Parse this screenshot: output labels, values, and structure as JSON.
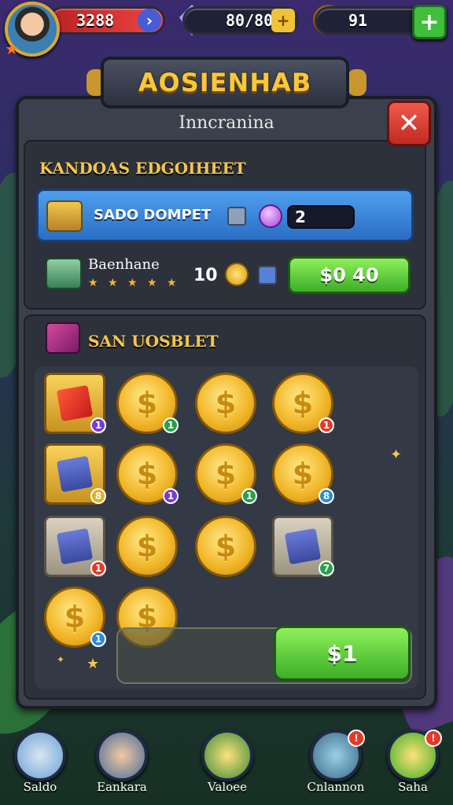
{
  "top_bar": {
    "health_value": "3288",
    "gems_value": "80/80",
    "coins_value": "91",
    "plus_label": "+"
  },
  "title": "AOSIENHAB",
  "panel": {
    "subtitle": "Inncranina",
    "close_label": "✕"
  },
  "section1": {
    "heading": "KANDOAS EDGOIHEET",
    "offer1": {
      "label": "SADO DOMPET",
      "quantity": "2"
    },
    "offer2": {
      "name": "Baenhane",
      "stars": "★ ★ ★ ★ ★",
      "count": "10",
      "price": "$0 40"
    }
  },
  "section2": {
    "heading": "SAN UOSBLET",
    "items": [
      {
        "type": "card",
        "badge": "1"
      },
      {
        "type": "coin",
        "badge": "1"
      },
      {
        "type": "coin",
        "badge": ""
      },
      {
        "type": "coin",
        "badge": "1"
      },
      {
        "type": "card",
        "badge": "8"
      },
      {
        "type": "coin",
        "badge": "1"
      },
      {
        "type": "coin",
        "badge": "1"
      },
      {
        "type": "coin",
        "badge": "8"
      },
      {
        "type": "card",
        "badge": "1"
      },
      {
        "type": "coin",
        "badge": ""
      },
      {
        "type": "coin",
        "badge": ""
      },
      {
        "type": "card",
        "badge": "7"
      },
      {
        "type": "coin",
        "badge": "1"
      },
      {
        "type": "coin",
        "badge": ""
      }
    ],
    "buy_label": "$1"
  },
  "bottom_nav": [
    {
      "label": "Saldo",
      "badge": ""
    },
    {
      "label": "Eankara",
      "badge": ""
    },
    {
      "label": "Valoee",
      "badge": ""
    },
    {
      "label": "Cnlannon",
      "badge": "!"
    },
    {
      "label": "Saha",
      "badge": "!"
    }
  ],
  "colors": {
    "gold_text": "#f8c73a",
    "buy_green": "#3cae28",
    "offer_blue": "#2a6dc4",
    "close_red": "#c22a22"
  }
}
